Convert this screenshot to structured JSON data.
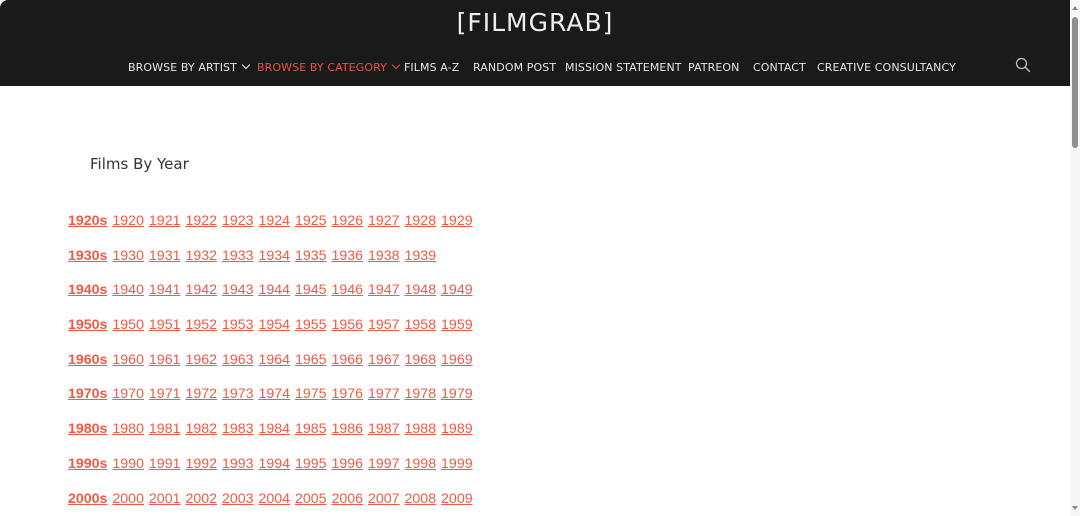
{
  "header": {
    "site_title": "[FILMGRAB]",
    "nav": [
      {
        "label": "BROWSE BY ARTIST",
        "has_dropdown": true,
        "active": false
      },
      {
        "label": "BROWSE BY CATEGORY",
        "has_dropdown": true,
        "active": true
      },
      {
        "label": "FILMS A-Z",
        "has_dropdown": false,
        "active": false
      },
      {
        "label": "RANDOM POST",
        "has_dropdown": false,
        "active": false
      },
      {
        "label": "MISSION STATEMENT",
        "has_dropdown": false,
        "active": false
      },
      {
        "label": "PATREON",
        "has_dropdown": false,
        "active": false
      },
      {
        "label": "CONTACT",
        "has_dropdown": false,
        "active": false
      },
      {
        "label": "CREATIVE CONSULTANCY",
        "has_dropdown": false,
        "active": false
      }
    ],
    "search_icon": "search-icon"
  },
  "main": {
    "title": "Films By Year",
    "decades": [
      {
        "label": "1920s",
        "years": [
          "1920",
          "1921",
          "1922",
          "1923",
          "1924",
          "1925",
          "1926",
          "1927",
          "1928",
          "1929"
        ]
      },
      {
        "label": "1930s",
        "years": [
          "1930",
          "1931",
          "1932",
          "1933",
          "1934",
          "1935",
          "1936",
          "1938",
          "1939"
        ]
      },
      {
        "label": "1940s",
        "years": [
          "1940",
          "1941",
          "1942",
          "1943",
          "1944",
          "1945",
          "1946",
          "1947",
          "1948",
          "1949"
        ]
      },
      {
        "label": "1950s",
        "years": [
          "1950",
          "1951",
          "1952",
          "1953",
          "1954",
          "1955",
          "1956",
          "1957",
          "1958",
          "1959"
        ]
      },
      {
        "label": "1960s",
        "years": [
          "1960",
          "1961",
          "1962",
          "1963",
          "1964",
          "1965",
          "1966",
          "1967",
          "1968",
          "1969"
        ]
      },
      {
        "label": "1970s",
        "years": [
          "1970",
          "1971",
          "1972",
          "1973",
          "1974",
          "1975",
          "1976",
          "1977",
          "1978",
          "1979"
        ]
      },
      {
        "label": "1980s",
        "years": [
          "1980",
          "1981",
          "1982",
          "1983",
          "1984",
          "1985",
          "1986",
          "1987",
          "1988",
          "1989"
        ]
      },
      {
        "label": "1990s",
        "years": [
          "1990",
          "1991",
          "1992",
          "1993",
          "1994",
          "1995",
          "1996",
          "1997",
          "1998",
          "1999"
        ]
      },
      {
        "label": "2000s",
        "years": [
          "2000",
          "2001",
          "2002",
          "2003",
          "2004",
          "2005",
          "2006",
          "2007",
          "2008",
          "2009"
        ]
      }
    ]
  },
  "colors": {
    "header_bg": "#1a1a1a",
    "accent": "#e8513f",
    "link": "#ee5a45",
    "nav_text": "#e6e6e6",
    "title_text": "#333333"
  }
}
